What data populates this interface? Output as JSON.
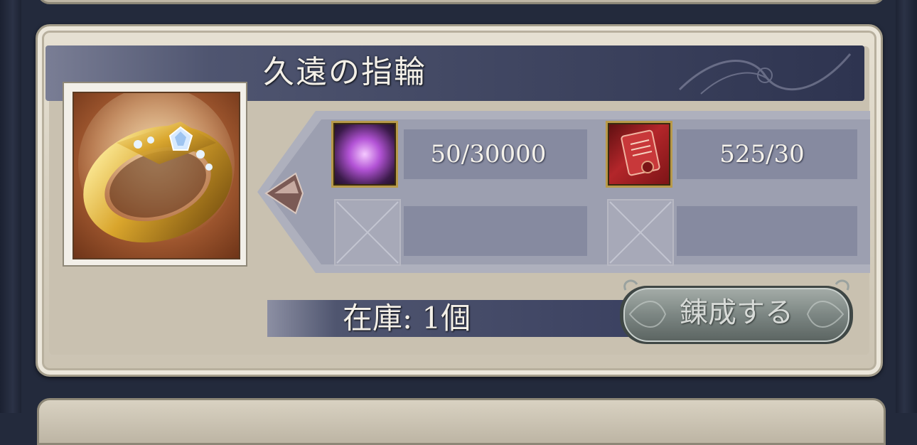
{
  "item": {
    "name": "久遠の指輪",
    "icon": "gold-ring-with-diamonds-icon"
  },
  "materials": [
    {
      "icon": "purple-gem-orb-icon",
      "count": "50/30000"
    },
    {
      "icon": "red-scroll-icon",
      "count": "525/30"
    },
    {
      "icon": "empty-slot-icon",
      "count": ""
    },
    {
      "icon": "empty-slot-icon",
      "count": ""
    }
  ],
  "stock": {
    "text": "在庫: 1個"
  },
  "craft_button": {
    "label": "錬成する"
  },
  "colors": {
    "panel": "#d4cdbd",
    "title_bar": "#2e3450",
    "gold_frame": "#b89a4a",
    "button": "#6f7a76"
  }
}
